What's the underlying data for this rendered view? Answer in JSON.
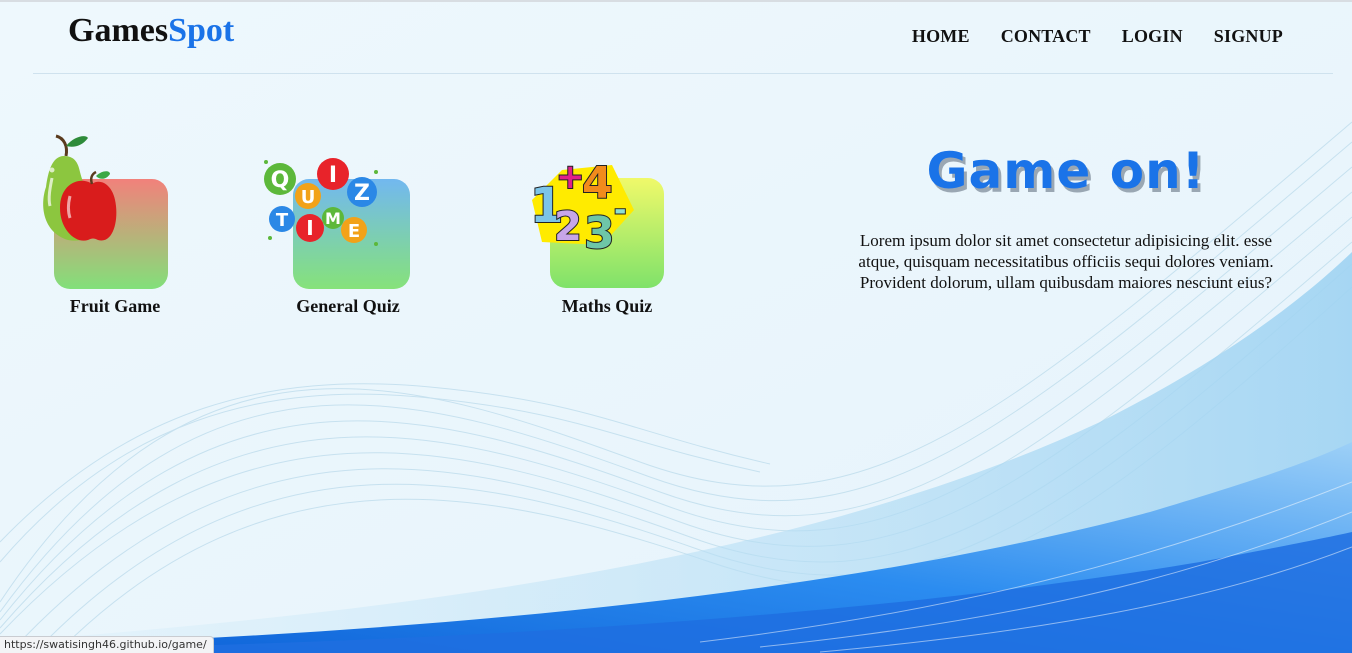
{
  "brand": {
    "part1": "Games",
    "part2": "Spot",
    "accent": "#1a73e8"
  },
  "nav": [
    "HOME",
    "CONTACT",
    "LOGIN",
    "SIGNUP"
  ],
  "games": [
    {
      "label": "Fruit Game",
      "icon": "fruit-icon"
    },
    {
      "label": "General Quiz",
      "icon": "quiz-time-icon"
    },
    {
      "label": "Maths Quiz",
      "icon": "numbers-icon"
    }
  ],
  "hero": {
    "title": "Game on!",
    "text": "Lorem ipsum dolor sit amet consectetur adipisicing elit. esse atque, quisquam necessitatibus officiis sequi dolores veniam. Provident dolorum, ullam quibusdam maiores nesciunt eius?"
  },
  "statusbar": {
    "url": "https://swatisingh46.github.io/game/"
  },
  "quiz_letters": [
    "Q",
    "U",
    "I",
    "Z",
    "T",
    "I",
    "M",
    "E"
  ],
  "math_glyphs": [
    "1",
    "+",
    "4",
    "2",
    "3",
    "-"
  ]
}
